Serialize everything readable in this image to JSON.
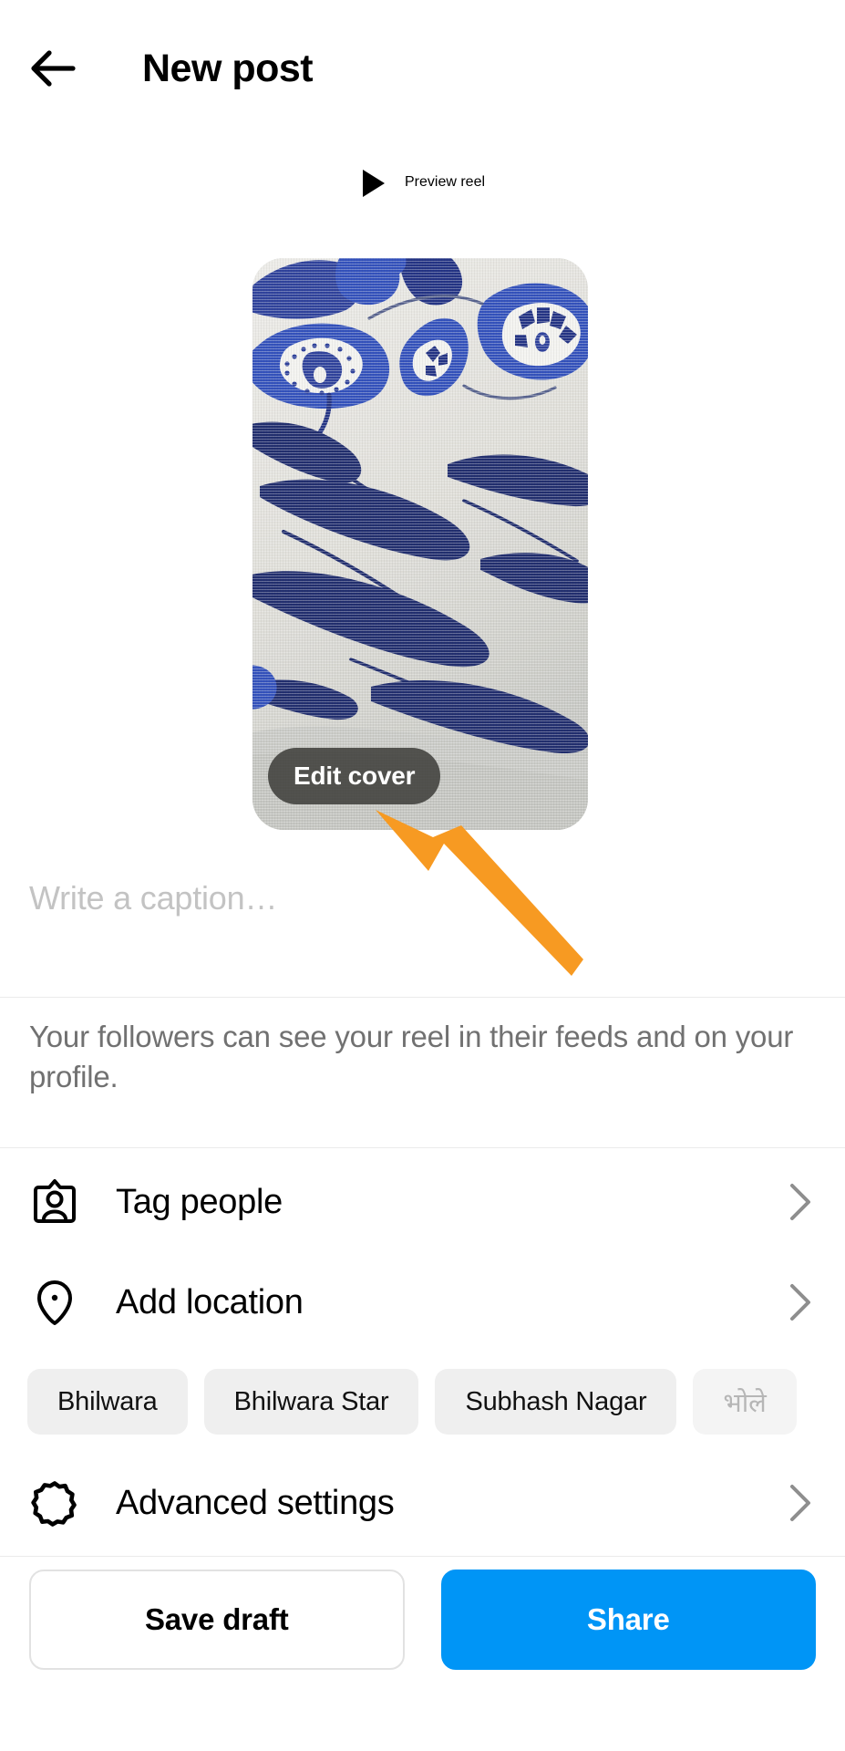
{
  "header": {
    "back_icon": "arrow-left-icon",
    "title": "New post"
  },
  "preview": {
    "play_icon": "play-icon",
    "label": "Preview reel"
  },
  "thumbnail": {
    "alt": "blue floral printed fabric",
    "edit_cover_label": "Edit cover"
  },
  "caption": {
    "placeholder": "Write a caption…",
    "value": ""
  },
  "audience_note": "Your followers can see your reel in their feeds and on your profile.",
  "options": [
    {
      "icon": "tag-people-icon",
      "label": "Tag people",
      "chevron": "chevron-right-icon"
    },
    {
      "icon": "location-pin-icon",
      "label": "Add location",
      "chevron": "chevron-right-icon"
    },
    {
      "icon": "gear-icon",
      "label": "Advanced settings",
      "chevron": "chevron-right-icon"
    }
  ],
  "location_chips": [
    {
      "label": "Bhilwara",
      "faded": false
    },
    {
      "label": "Bhilwara Star",
      "faded": false
    },
    {
      "label": "Subhash Nagar",
      "faded": false
    },
    {
      "label": "भोले",
      "faded": true
    }
  ],
  "actions": {
    "save_draft_label": "Save draft",
    "share_label": "Share",
    "share_color": "#0095f6"
  },
  "annotation": {
    "arrow_color": "#f79a22",
    "points_to": "Edit cover"
  }
}
